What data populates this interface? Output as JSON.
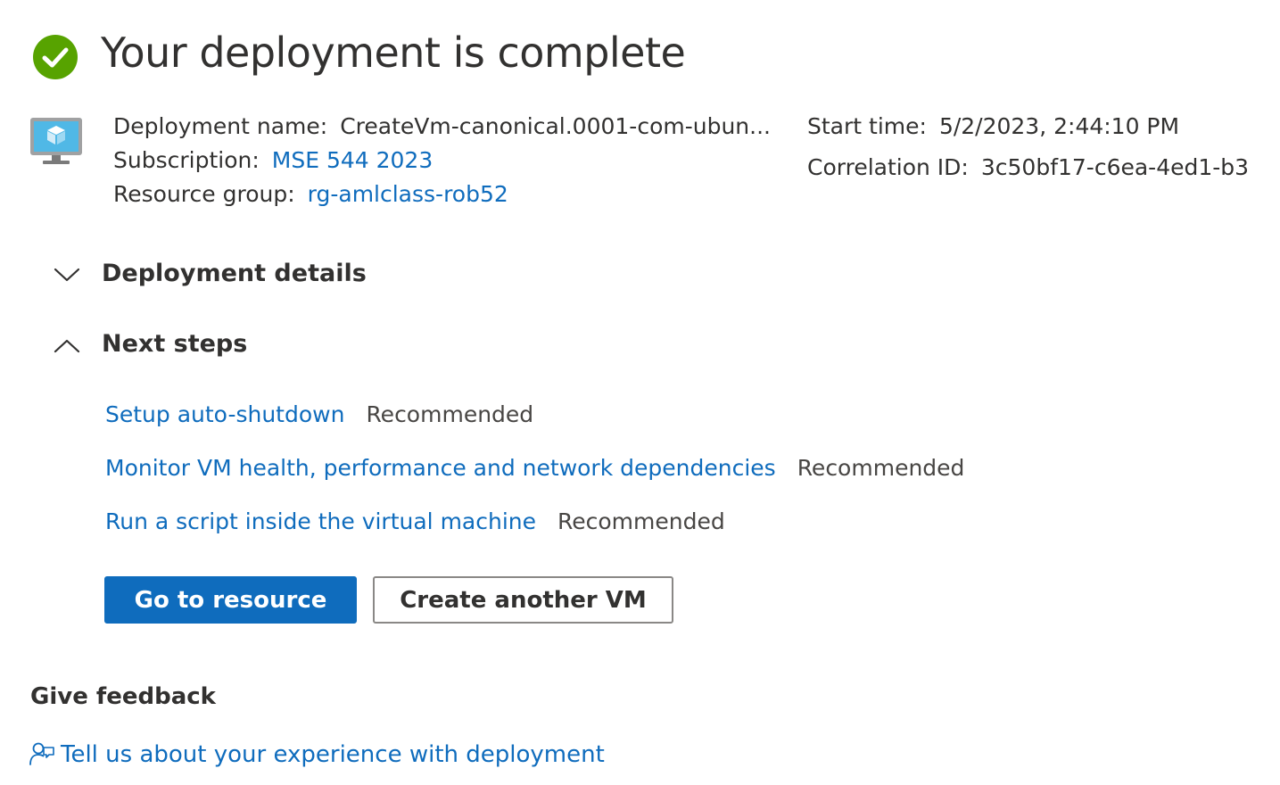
{
  "header": {
    "title": "Your deployment is complete",
    "status_icon": "check-circle-icon",
    "status_color": "#57a300"
  },
  "deployment": {
    "icon": "virtual-machine-icon",
    "name_label": "Deployment name:",
    "name_value": "CreateVm-canonical.0001-com-ubun...",
    "subscription_label": "Subscription:",
    "subscription_value": "MSE 544 2023",
    "resource_group_label": "Resource group:",
    "resource_group_value": "rg-amlclass-rob52",
    "start_time_label": "Start time:",
    "start_time_value": "5/2/2023, 2:44:10 PM",
    "correlation_id_label": "Correlation ID:",
    "correlation_id_value": "3c50bf17-c6ea-4ed1-b3"
  },
  "sections": {
    "deployment_details": {
      "title": "Deployment details",
      "icon": "chevron-down-icon",
      "expanded": false
    },
    "next_steps": {
      "title": "Next steps",
      "icon": "chevron-up-icon",
      "expanded": true,
      "items": [
        {
          "label": "Setup auto-shutdown",
          "tag": "Recommended"
        },
        {
          "label": "Monitor VM health, performance and network dependencies",
          "tag": "Recommended"
        },
        {
          "label": "Run a script inside the virtual machine",
          "tag": "Recommended"
        }
      ]
    }
  },
  "actions": {
    "primary_label": "Go to resource",
    "secondary_label": "Create another VM"
  },
  "feedback": {
    "title": "Give feedback",
    "link_label": "Tell us about your experience with deployment",
    "icon": "feedback-person-icon"
  },
  "colors": {
    "link": "#0f6cbd",
    "primary_button": "#0f6cbd",
    "text": "#323130",
    "success": "#57a300"
  }
}
